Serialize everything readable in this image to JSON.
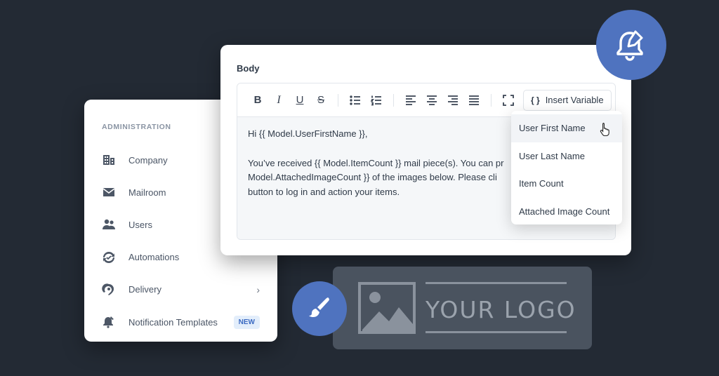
{
  "sidebar": {
    "heading": "ADMINISTRATION",
    "items": [
      {
        "label": "Company",
        "icon": "building-icon"
      },
      {
        "label": "Mailroom",
        "icon": "envelope-icon"
      },
      {
        "label": "Users",
        "icon": "users-icon"
      },
      {
        "label": "Automations",
        "icon": "refresh-check-icon"
      },
      {
        "label": "Delivery",
        "icon": "delivery-pin-icon"
      },
      {
        "label": "Notification Templates",
        "icon": "bell-edit-icon",
        "badge": "NEW"
      }
    ]
  },
  "editor": {
    "title": "Body",
    "toolbar": {
      "insert_variable_label": "Insert Variable"
    },
    "body_lines": [
      "Hi {{ Model.UserFirstName }},",
      "",
      "You’ve received {{ Model.ItemCount }} mail piece(s). You can pr",
      "Model.AttachedImageCount }} of the images below. Please cli",
      "button to log in and action your items."
    ]
  },
  "dropdown": {
    "items": [
      "User First Name",
      "User Last Name",
      "Item Count",
      "Attached Image Count"
    ],
    "active_index": 0
  },
  "logo_placeholder": {
    "text": "YOUR LOGO"
  },
  "colors": {
    "background": "#232a34",
    "accent": "#4f73bf",
    "badge_bg": "#e3eefb",
    "badge_text": "#3c6bc2"
  }
}
